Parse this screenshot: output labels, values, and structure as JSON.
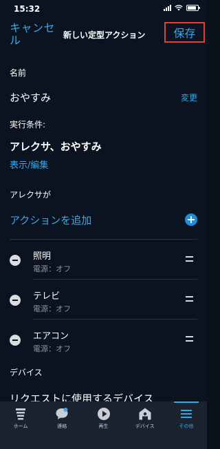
{
  "status": {
    "time": "15:32"
  },
  "header": {
    "cancel": "キャンセル",
    "title": "新しい定型アクション",
    "save": "保存"
  },
  "name_section": {
    "label": "名前",
    "value": "おやすみ",
    "change": "変更"
  },
  "trigger_section": {
    "label": "実行条件:",
    "title": "アレクサ、おやすみ",
    "edit": "表示/編集"
  },
  "alexa_section": {
    "label": "アレクサが",
    "add_action": "アクションを追加"
  },
  "actions": [
    {
      "name": "照明",
      "sub": "電源：オフ"
    },
    {
      "name": "テレビ",
      "sub": "電源：オフ"
    },
    {
      "name": "エアコン",
      "sub": "電源：オフ"
    }
  ],
  "device_section": {
    "label": "デバイス",
    "row": "リクエストに使用するデバイス"
  },
  "tabs": [
    {
      "label": "ホーム",
      "icon": "home-icon"
    },
    {
      "label": "連絡",
      "icon": "chat-icon"
    },
    {
      "label": "再生",
      "icon": "play-icon"
    },
    {
      "label": "デバイス",
      "icon": "devices-icon"
    },
    {
      "label": "その他",
      "icon": "menu-icon",
      "active": true
    }
  ],
  "colors": {
    "accent": "#3aa8e6",
    "background": "#0b1320",
    "highlight": "#e8412b"
  }
}
